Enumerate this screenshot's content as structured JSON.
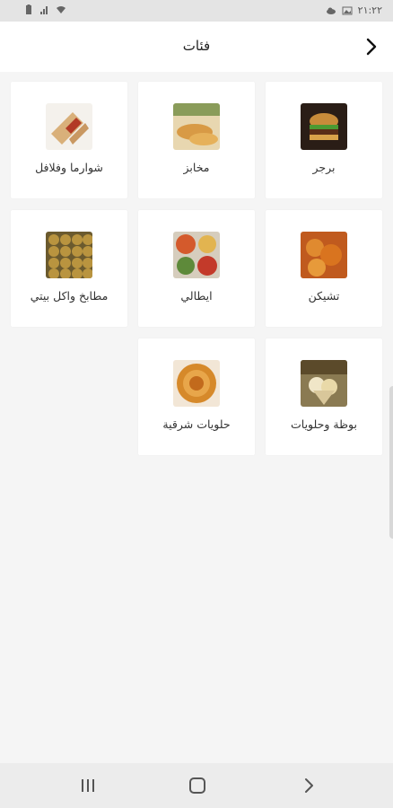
{
  "status_bar": {
    "time": "٢١:٢٢"
  },
  "header": {
    "title": "فئات"
  },
  "categories": [
    {
      "label": "برجر",
      "icon": "burger-photo"
    },
    {
      "label": "مخابز",
      "icon": "bakery-photo"
    },
    {
      "label": "شوارما وفلافل",
      "icon": "shawarma-photo"
    },
    {
      "label": "تشيكن",
      "icon": "chicken-photo"
    },
    {
      "label": "ايطالي",
      "icon": "italian-photo"
    },
    {
      "label": "مطابخ واكل بيتي",
      "icon": "home-food-photo"
    },
    {
      "label": "بوظة وحلويات",
      "icon": "icecream-photo"
    },
    {
      "label": "حلويات شرقية",
      "icon": "oriental-sweets-photo"
    }
  ],
  "colors": {
    "card": "#ffffff",
    "background": "#f5f5f5",
    "text": "#333333"
  }
}
